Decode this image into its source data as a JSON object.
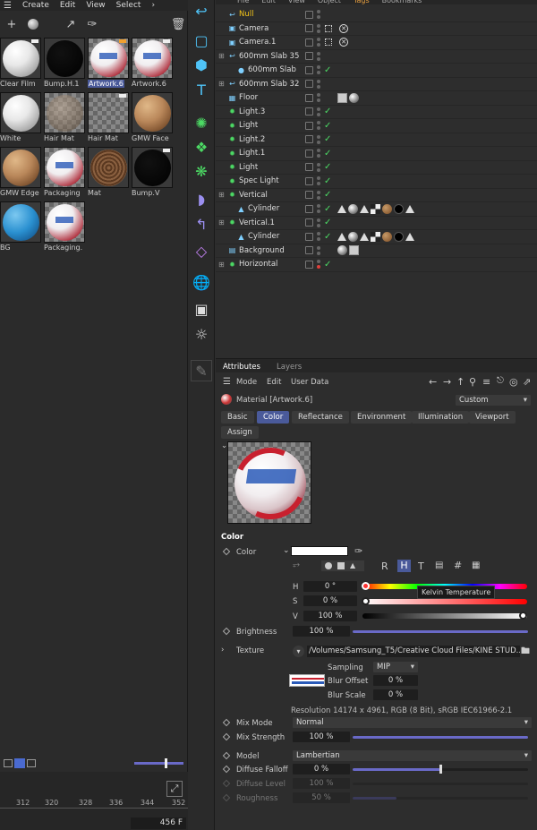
{
  "menu": [
    "Create",
    "Edit",
    "View",
    "Select"
  ],
  "materials": [
    {
      "name": "Clear Film",
      "kind": "white",
      "selected": false
    },
    {
      "name": "Bump.H.1",
      "kind": "black",
      "selected": false
    },
    {
      "name": "Artwork.6",
      "kind": "packaging",
      "selected": true
    },
    {
      "name": "Artwork.6",
      "kind": "packaging",
      "selected": false
    },
    {
      "name": "White",
      "kind": "white",
      "selected": false
    },
    {
      "name": "Hair Mat",
      "kind": "hair",
      "selected": false
    },
    {
      "name": "Hair Mat",
      "kind": "checker",
      "selected": false
    },
    {
      "name": "GMW Face",
      "kind": "wood",
      "selected": false
    },
    {
      "name": "GMW Edge",
      "kind": "wood",
      "selected": false
    },
    {
      "name": "Packaging",
      "kind": "packaging",
      "selected": false
    },
    {
      "name": "Mat",
      "kind": "rattan",
      "selected": false
    },
    {
      "name": "Bump.V",
      "kind": "black",
      "selected": false
    },
    {
      "name": "BG",
      "kind": "blue",
      "selected": false
    },
    {
      "name": "Packaging.",
      "kind": "packaging",
      "selected": false
    }
  ],
  "timeline": {
    "ticks": [
      "312",
      "320",
      "328",
      "336",
      "344",
      "352"
    ],
    "current_frame": "456 F"
  },
  "objmgr": {
    "menu": [
      "File",
      "Edit",
      "View",
      "Object",
      "Tags",
      "Bookmarks"
    ]
  },
  "objects": [
    {
      "name": "Null",
      "indent": 0,
      "icon": "null-icon",
      "color": "#f5c518",
      "status": "none",
      "tags": []
    },
    {
      "name": "Camera",
      "indent": 0,
      "icon": "camera-icon",
      "status": "x",
      "tags": []
    },
    {
      "name": "Camera.1",
      "indent": 0,
      "icon": "camera-icon",
      "status": "x",
      "tags": []
    },
    {
      "name": "600mm Slab 35",
      "indent": 0,
      "icon": "null-icon",
      "status": "none",
      "tags": []
    },
    {
      "name": "600mm Slab",
      "indent": 1,
      "icon": "sphere-icon",
      "status": "check",
      "tags": []
    },
    {
      "name": "600mm Slab 32",
      "indent": 0,
      "icon": "null-icon",
      "status": "none",
      "tags": []
    },
    {
      "name": "Floor",
      "indent": 0,
      "icon": "floor-icon",
      "status": "none",
      "tags": [
        "tex",
        "mat"
      ]
    },
    {
      "name": "Light.3",
      "indent": 0,
      "icon": "light-icon",
      "status": "check",
      "tags": []
    },
    {
      "name": "Light",
      "indent": 0,
      "icon": "light-icon",
      "status": "check",
      "tags": []
    },
    {
      "name": "Light.2",
      "indent": 0,
      "icon": "light-icon",
      "status": "check",
      "tags": []
    },
    {
      "name": "Light.1",
      "indent": 0,
      "icon": "light-icon",
      "status": "check",
      "tags": []
    },
    {
      "name": "Light",
      "indent": 0,
      "icon": "light-icon",
      "status": "check",
      "tags": []
    },
    {
      "name": "Spec Light",
      "indent": 0,
      "icon": "light-icon",
      "status": "check",
      "tags": []
    },
    {
      "name": "Vertical",
      "indent": 0,
      "icon": "cloner-icon",
      "status": "check",
      "tags": []
    },
    {
      "name": "Cylinder",
      "indent": 1,
      "icon": "cylinder-icon",
      "status": "check",
      "tags": [
        "tri",
        "mat",
        "tri",
        "chk2",
        "wood",
        "dark",
        "tri"
      ]
    },
    {
      "name": "Vertical.1",
      "indent": 0,
      "icon": "cloner-icon",
      "status": "check",
      "tags": []
    },
    {
      "name": "Cylinder",
      "indent": 1,
      "icon": "cylinder-icon",
      "status": "check",
      "tags": [
        "tri",
        "mat",
        "tri",
        "chk2",
        "wood",
        "dark",
        "tri"
      ]
    },
    {
      "name": "Background",
      "indent": 0,
      "icon": "background-icon",
      "status": "none",
      "tags": [
        "mat",
        "tex"
      ]
    },
    {
      "name": "Horizontal",
      "indent": 0,
      "icon": "cloner-icon",
      "status": "check-red",
      "tags": []
    }
  ],
  "attr": {
    "tabs_top": [
      "Attributes",
      "Layers"
    ],
    "menu": [
      "Mode",
      "Edit",
      "User Data"
    ],
    "material_title": "Material [Artwork.6]",
    "layout_preset": "Custom",
    "tabs": [
      "Basic",
      "Color",
      "Reflectance",
      "Environment",
      "Illumination",
      "Viewport",
      "Assign"
    ],
    "active_tab": "Color",
    "section": "Color",
    "color_label": "Color",
    "color_value": "#ffffff",
    "mode_buttons": [
      "R",
      "H",
      "T",
      "#"
    ],
    "active_mode": "H",
    "tooltip": "Kelvin Temperature",
    "h_label": "H",
    "h_value": "0 °",
    "s_label": "S",
    "s_value": "0 %",
    "v_label": "V",
    "v_value": "100 %",
    "brightness_label": "Brightness",
    "brightness_value": "100 %",
    "brightness": 1.0,
    "texture_label": "Texture",
    "texture_path": "/Volumes/Samsung_T5/Creative Cloud Files/KINE STUD...",
    "sampling_label": "Sampling",
    "sampling_value": "MIP",
    "blur_offset_label": "Blur Offset",
    "blur_offset_value": "0 %",
    "blur_scale_label": "Blur Scale",
    "blur_scale_value": "0 %",
    "resolution": "Resolution 14174 x 4961, RGB (8 Bit), sRGB IEC61966-2.1",
    "mix_mode_label": "Mix Mode",
    "mix_mode_value": "Normal",
    "mix_strength_label": "Mix Strength",
    "mix_strength_value": "100 %",
    "mix_strength": 1.0,
    "model_label": "Model",
    "model_value": "Lambertian",
    "diffuse_falloff_label": "Diffuse Falloff",
    "diffuse_falloff_value": "0 %",
    "diffuse_falloff": 0.5,
    "diffuse_level_label": "Diffuse Level",
    "diffuse_level_value": "100 %",
    "roughness_label": "Roughness",
    "roughness_value": "50 %",
    "roughness": 0.25
  },
  "colors": {
    "accent": "#4a5a9a",
    "check": "#4cd964",
    "light_icon": "#4cd964",
    "camera_icon": "#7fd0ff"
  }
}
